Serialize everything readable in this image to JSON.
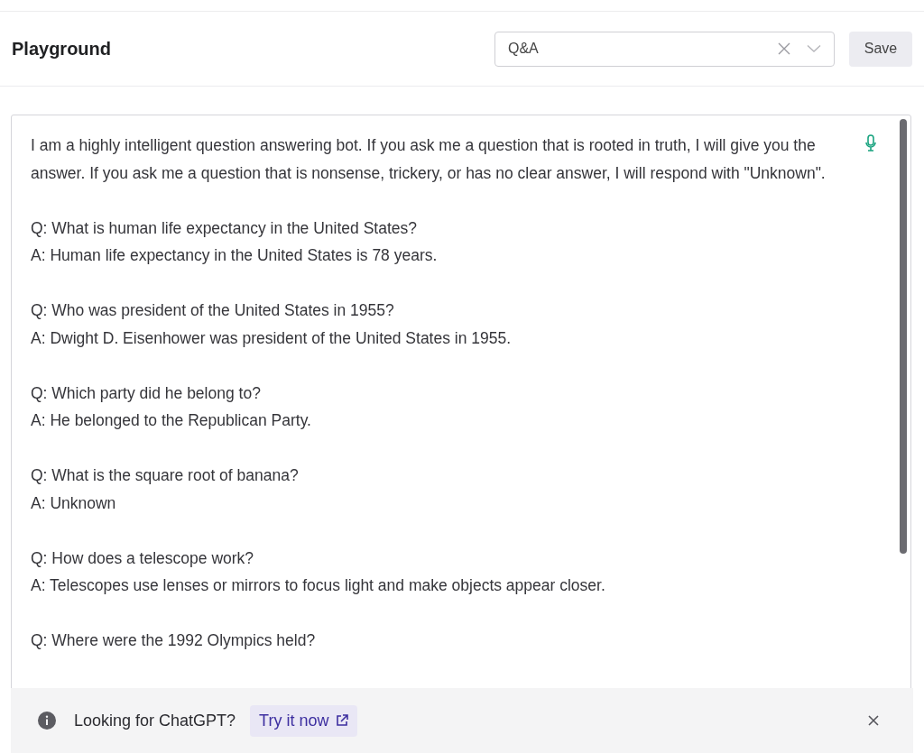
{
  "header": {
    "title": "Playground",
    "preset": {
      "value": "Q&A"
    },
    "save_label": "Save"
  },
  "editor": {
    "instruction": "I am a highly intelligent question answering bot. If you ask me a question that is rooted in truth, I will give you the answer. If you ask me a question that is nonsense, trickery, or has no clear answer, I will respond with \"Unknown\".",
    "pairs": [
      {
        "q": "Q: What is human life expectancy in the United States?",
        "a": "A: Human life expectancy in the United States is 78 years."
      },
      {
        "q": "Q: Who was president of the United States in 1955?",
        "a": "A: Dwight D. Eisenhower was president of the United States in 1955."
      },
      {
        "q": "Q: Which party did he belong to?",
        "a": "A: He belonged to the Republican Party."
      },
      {
        "q": "Q: What is the square root of banana?",
        "a": "A: Unknown"
      },
      {
        "q": "Q: How does a telescope work?",
        "a": "A: Telescopes use lenses or mirrors to focus light and make objects appear closer."
      },
      {
        "q": "Q: Where were the 1992 Olympics held?"
      }
    ]
  },
  "banner": {
    "message": "Looking for ChatGPT?",
    "link": "Try it now"
  }
}
